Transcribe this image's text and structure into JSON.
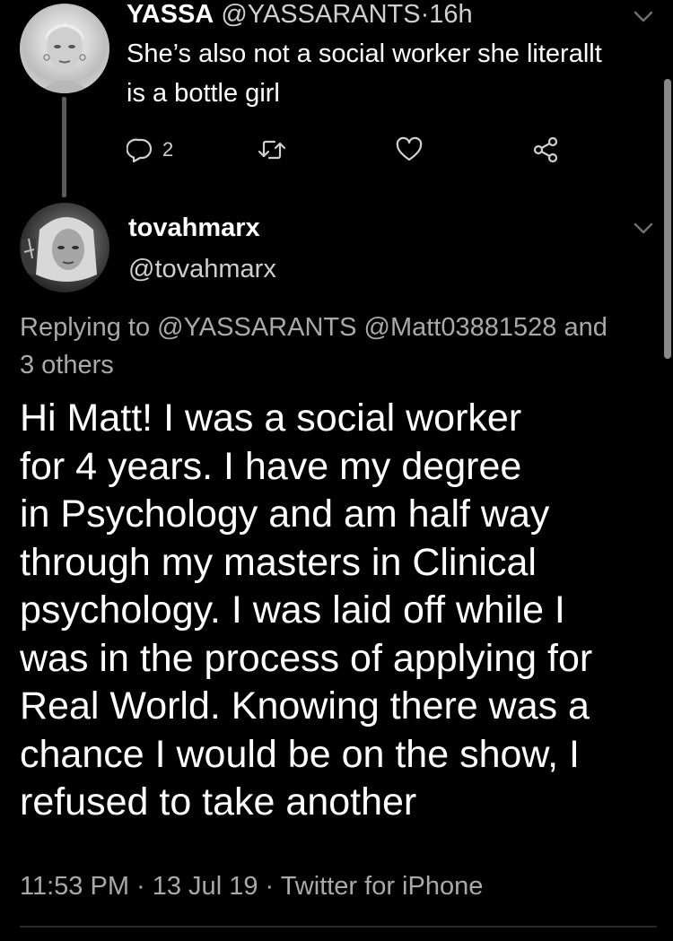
{
  "parent_tweet": {
    "display_name": "YASSA",
    "handle": "@YASSARANTS",
    "separator": "·",
    "time": "16h",
    "text_lines": [
      "She’s also not a social worker she literallt",
      "is a bottle girl"
    ],
    "reply_count": "2",
    "avatar_icon": "profile-photo",
    "caret_icon": "chevron-down-icon"
  },
  "main_tweet": {
    "display_name": "tovahmarx",
    "handle": "@tovahmarx",
    "replying_prefix": "Replying to",
    "replying_mentions": "@YASSARANTS @Matt03881528",
    "replying_suffix_1": "and",
    "replying_suffix_2": "3 others",
    "text_lines": [
      "Hi Matt! I was a social worker",
      "for 4 years. I have my degree",
      "in Psychology and am half way",
      "through my masters in Clinical",
      "psychology. I was laid off while I",
      "was in the process of applying for",
      "Real World. Knowing there was a",
      "chance I would be on the show, I",
      "refused to take another"
    ],
    "meta": "11:53 PM · 13 Jul 19 · Twitter for iPhone"
  },
  "colors": {
    "background": "#000000",
    "primary_text": "#ffffff",
    "secondary_text": "#a9a9a9",
    "icon": "#cfcfcf"
  }
}
